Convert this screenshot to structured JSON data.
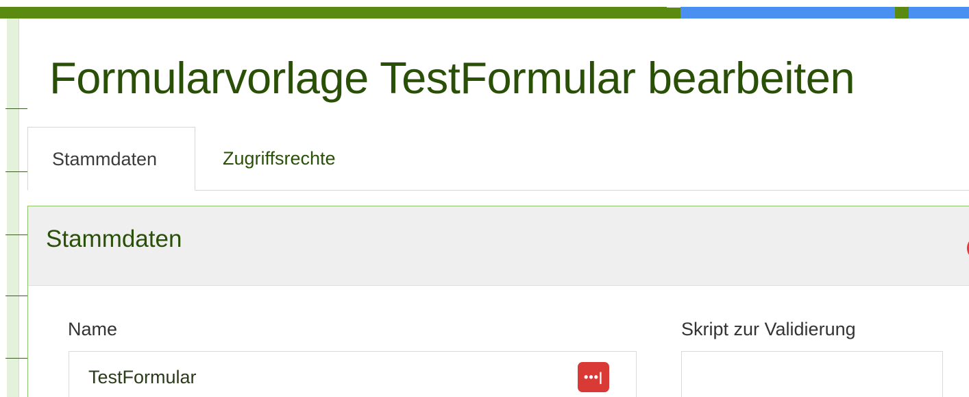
{
  "page": {
    "title": "Formularvorlage TestFormular bearbeiten"
  },
  "tabs": [
    {
      "label": "Stammdaten",
      "active": true
    },
    {
      "label": "Zugriffsrechte",
      "active": false
    }
  ],
  "panel": {
    "title": "Stammdaten"
  },
  "form": {
    "name_label": "Name",
    "name_value": "TestFormular",
    "script_label": "Skript zur Validierung",
    "script_value": ""
  },
  "icons": {
    "password_manager": "password-manager-icon",
    "password_manager_glyph": "•••|"
  },
  "colors": {
    "brand_green": "#5a8a10",
    "title_green": "#2a5008",
    "accent_blue": "#4a90f0",
    "icon_red": "#d93a35"
  }
}
